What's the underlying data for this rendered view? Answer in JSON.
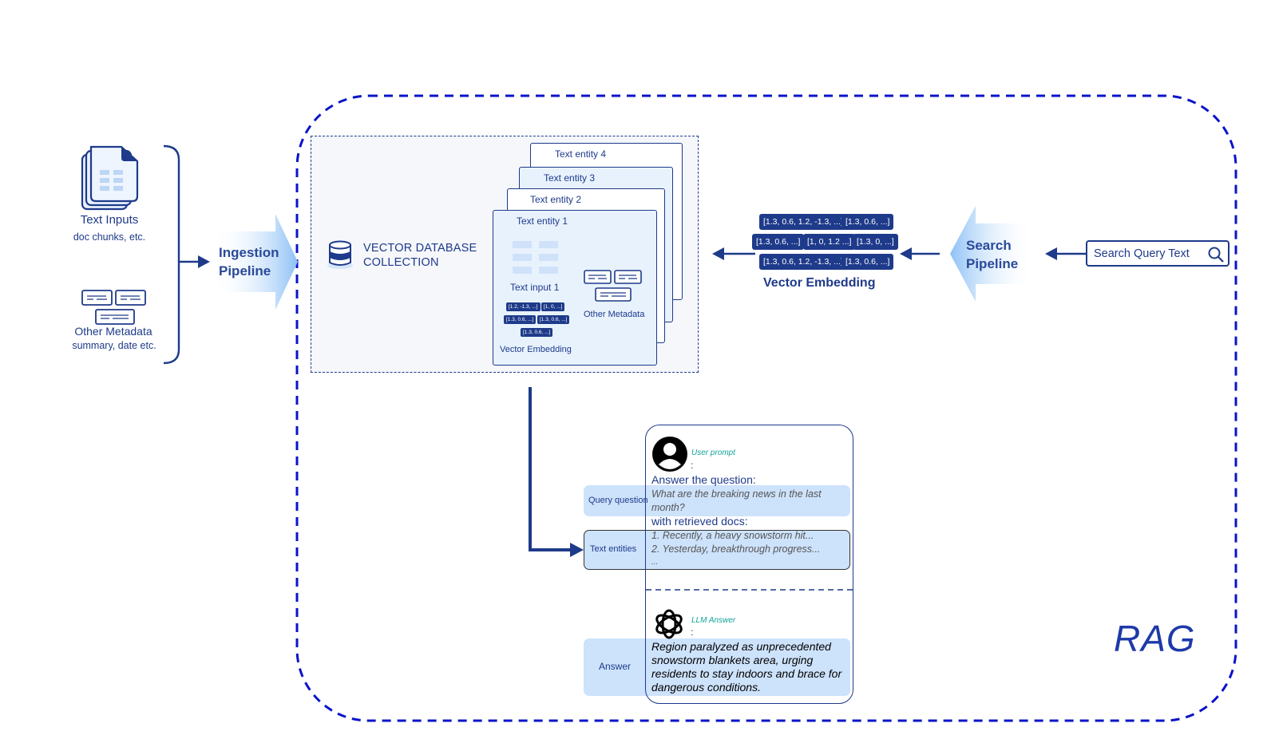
{
  "inputs": {
    "text_inputs": {
      "title": "Text Inputs",
      "subtitle": "doc chunks, etc."
    },
    "other_metadata": {
      "title": "Other Metadata",
      "subtitle": "summary, date etc."
    }
  },
  "ingestion_pipeline": {
    "line1": "Ingestion",
    "line2": "Pipeline"
  },
  "vector_db": {
    "title_line1": "VECTOR DATABASE",
    "title_line2": "COLLECTION",
    "entities": [
      "Text entity 1",
      "Text entity 2",
      "Text entity 3",
      "Text entity 4"
    ],
    "entity1": {
      "text_input_label": "Text input 1",
      "metadata_label": "Other Metadata",
      "embedding_label": "Vector Embedding",
      "embedding_chips": [
        "[1.2, -1.3, ...]",
        "[1, 0, ...]",
        "[1.3, 0.6, ...]",
        "[1.3, 0.6, ...]",
        "[1.3, 0.6, ...]"
      ]
    }
  },
  "query_embedding": {
    "label": "Vector Embedding",
    "rows": [
      [
        "[1.3, 0.6, 1.2, -1.3, ...]",
        "[1.3, 0.6, ...]"
      ],
      [
        "[1.3, 0.6, ...]",
        "[1, 0, 1.2 ...]",
        "[1.3, 0, ...]"
      ],
      [
        "[1.3, 0.6, 1.2, -1.3, ...]",
        "[1.3, 0.6, ...]"
      ]
    ]
  },
  "search_pipeline": {
    "line1": "Search",
    "line2": "Pipeline"
  },
  "search_query": {
    "text": "Search Query Text",
    "icon": "search-icon"
  },
  "prompt": {
    "user_role": "User  prompt",
    "colon": ":",
    "answer_the_question": "Answer the question:",
    "question_line1": " What are the breaking news in the last",
    "question_line2": "month?",
    "with_docs": " with retrieved docs:",
    "docs": [
      "1. Recently, a heavy snowstorm hit...",
      "2. Yesterday, breakthrough progress...",
      "..."
    ],
    "llm_role": "LLM Answer",
    "answer_lines": [
      "Region paralyzed as unprecedented",
      "snowstorm blankets area, urging",
      "residents to stay indoors and brace for",
      "dangerous conditions."
    ],
    "side_labels": {
      "query_question": "Query question",
      "text_entities": "Text entities",
      "answer": "Answer"
    }
  },
  "rag_label": "RAG",
  "colors": {
    "navy": "#1e3a8a",
    "rag_border": "#0a14c8",
    "highlight": "#cde2fb",
    "role_teal": "#10a39a"
  }
}
